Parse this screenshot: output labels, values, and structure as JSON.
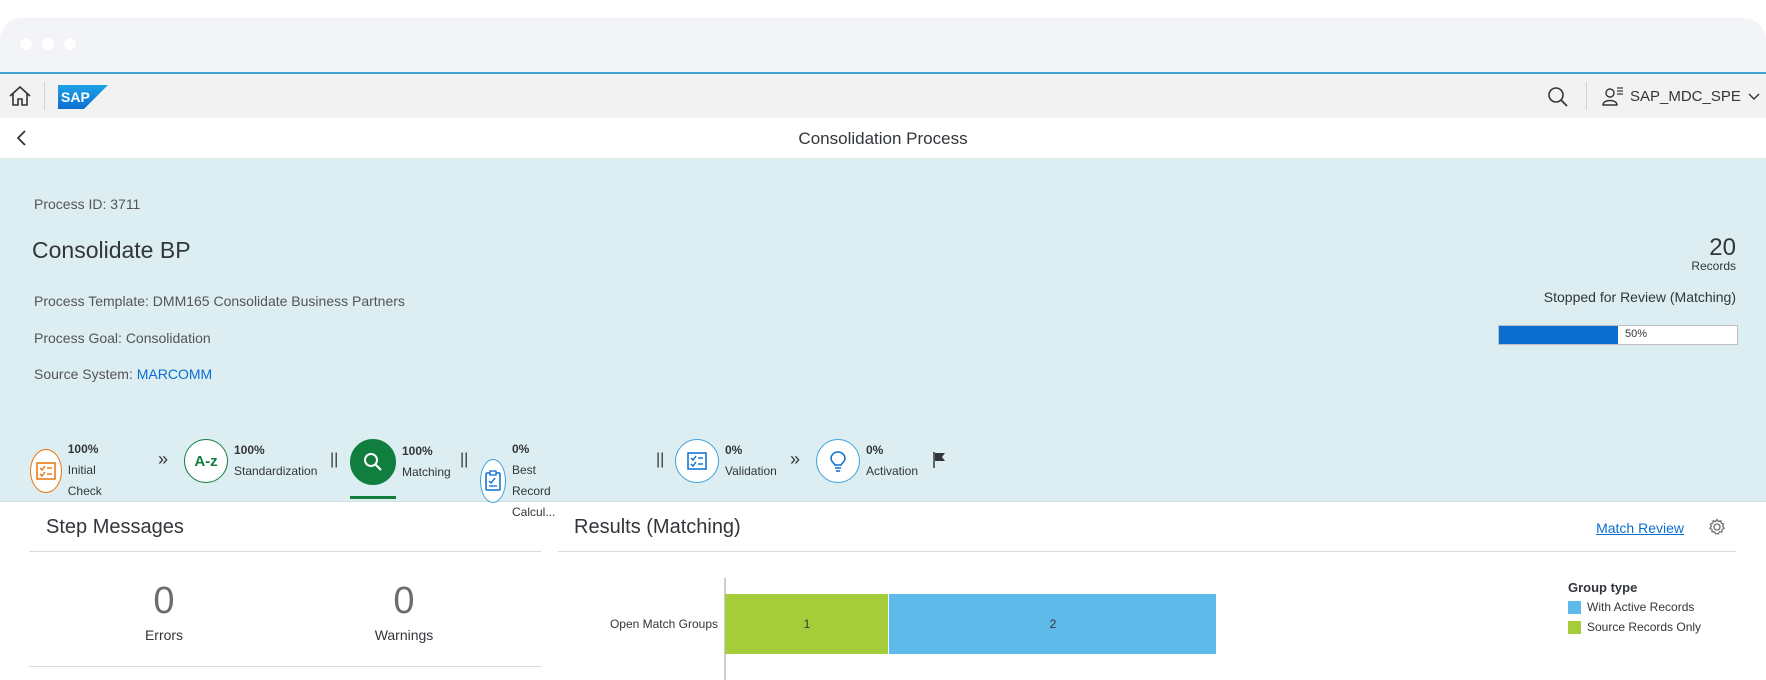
{
  "shell": {
    "logo": "SAP",
    "user_name": "SAP_MDC_SPE"
  },
  "page": {
    "title": "Consolidation Process"
  },
  "header": {
    "process_id": "Process ID: 3711",
    "process_name": "Consolidate BP",
    "template": "Process Template: DMM165 Consolidate Business Partners",
    "goal": "Process Goal: Consolidation",
    "source_label": "Source System:",
    "source_value": "MARCOMM",
    "records_count": "20",
    "records_label": "Records",
    "status": "Stopped for Review (Matching)",
    "progress_value": 50,
    "progress_text": "50%"
  },
  "steps": [
    {
      "pct": "100%",
      "label": "Initial Check",
      "color": "#e9730c",
      "icon": "checklist-icon"
    },
    {
      "pct": "100%",
      "label": "Standardization",
      "color": "#107e3e",
      "icon": "a-z-icon"
    },
    {
      "pct": "100%",
      "label": "Matching",
      "color": "#107e3e",
      "icon": "search-icon",
      "active": true
    },
    {
      "pct": "0%",
      "label": "Best Record Calcul...",
      "color": "#3fa2d5",
      "icon": "clipboard-icon"
    },
    {
      "pct": "0%",
      "label": "Validation",
      "color": "#3fa2d5",
      "icon": "checklist-icon"
    },
    {
      "pct": "0%",
      "label": "Activation",
      "color": "#3fa2d5",
      "icon": "lightbulb-icon"
    }
  ],
  "step_messages": {
    "title": "Step Messages",
    "errors_count": "0",
    "errors_label": "Errors",
    "warnings_count": "0",
    "warnings_label": "Warnings"
  },
  "results": {
    "title": "Results (Matching)",
    "match_review_link": "Match Review"
  },
  "chart_data": {
    "type": "bar",
    "orientation": "horizontal",
    "stacked": true,
    "categories": [
      "Open Match Groups"
    ],
    "series": [
      {
        "name": "Source Records Only",
        "values": [
          1
        ],
        "color": "#a5cd3a"
      },
      {
        "name": "With Active Records",
        "values": [
          2
        ],
        "color": "#5ebae8"
      }
    ],
    "legend_title": "Group type",
    "legend_items": [
      "With Active Records",
      "Source Records Only"
    ],
    "legend_colors": [
      "#5ebae8",
      "#a5cd3a"
    ],
    "legend_position": "right"
  }
}
